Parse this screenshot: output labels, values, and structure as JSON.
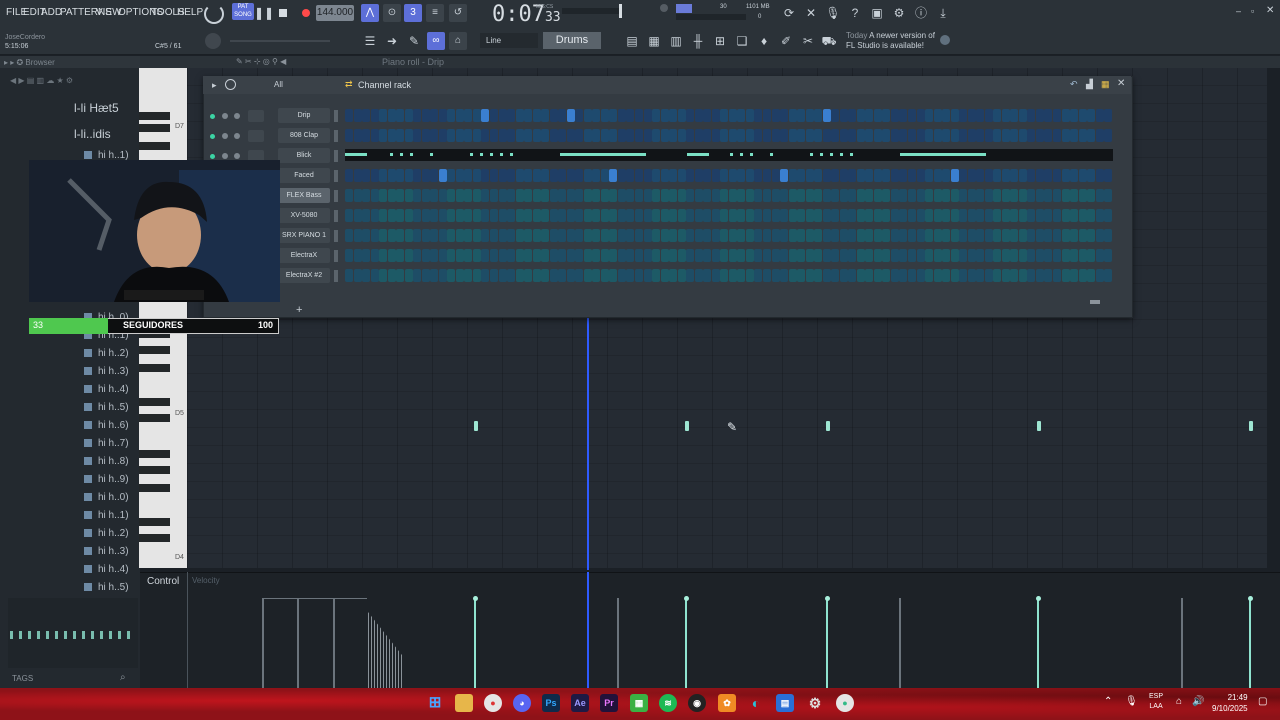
{
  "menubar": {
    "items": [
      "FILE",
      "EDIT",
      "ADD",
      "PATTERNS",
      "VIEW",
      "OPTIONS",
      "TOOLS",
      "HELP"
    ],
    "tempo": "144.000",
    "time_main": "0:07",
    "time_small": "33",
    "time_label": "M:S:CS",
    "mode_pat": "PAT",
    "mode_song": "SONG",
    "snap_mode": "Line",
    "pattern_name": "Drums",
    "memory": "1101 MB",
    "cpu": "30",
    "voices": "0",
    "hint_prefix": "Today",
    "hint_line1": "A newer version of",
    "hint_line2": "FL Studio is available!",
    "user_label": "JoseCordero",
    "position_label": "5:15:06",
    "note_label": "C#5 / 61",
    "pianoroll_title": "Piano roll - Drip"
  },
  "browser": {
    "title": "Browser",
    "items": [
      "l-li Hæt5",
      "l-li..idis",
      "hi h..1)",
      "hi h..0)",
      "hi h..1)",
      "hi h..2)",
      "hi h..3)",
      "hi h..4)",
      "hi h..5)",
      "hi h..6)",
      "hi h..7)",
      "hi h..8)",
      "hi h..9)",
      "hi h..0)",
      "hi h..1)",
      "hi h..2)",
      "hi h..3)",
      "hi h..4)",
      "hi h..5)"
    ],
    "tags": "TAGS"
  },
  "piano": {
    "labels": [
      "D7",
      "D5",
      "D4"
    ]
  },
  "channel_rack": {
    "title": "Channel rack",
    "filter": "All",
    "channels": [
      {
        "name": "Drip",
        "selected": false
      },
      {
        "name": "808 Clap",
        "selected": false
      },
      {
        "name": "Blick",
        "selected": false
      },
      {
        "name": "Faced",
        "selected": false
      },
      {
        "name": "FLEX Bass",
        "selected": true
      },
      {
        "name": "XV-5080",
        "selected": false
      },
      {
        "name": "SRX PIANO 1",
        "selected": false
      },
      {
        "name": "ElectraX",
        "selected": false
      },
      {
        "name": "ElectraX #2",
        "selected": false
      }
    ],
    "add_label": "+"
  },
  "control": {
    "label": "Control",
    "param": "Velocity"
  },
  "followers": {
    "label": "SEGUIDORES",
    "current": "33",
    "goal": "100",
    "progress": 0.33
  },
  "taskbar": {
    "language_top": "ESP",
    "language_bottom": "LAA",
    "time": "21:49",
    "date": "9/10/2025"
  },
  "colors": {
    "accent": "#5d6fd8",
    "note": "#9ee6d2",
    "playhead": "#2f5bff",
    "followers_fill": "#4fc84f",
    "taskbar": "#8e1218"
  }
}
